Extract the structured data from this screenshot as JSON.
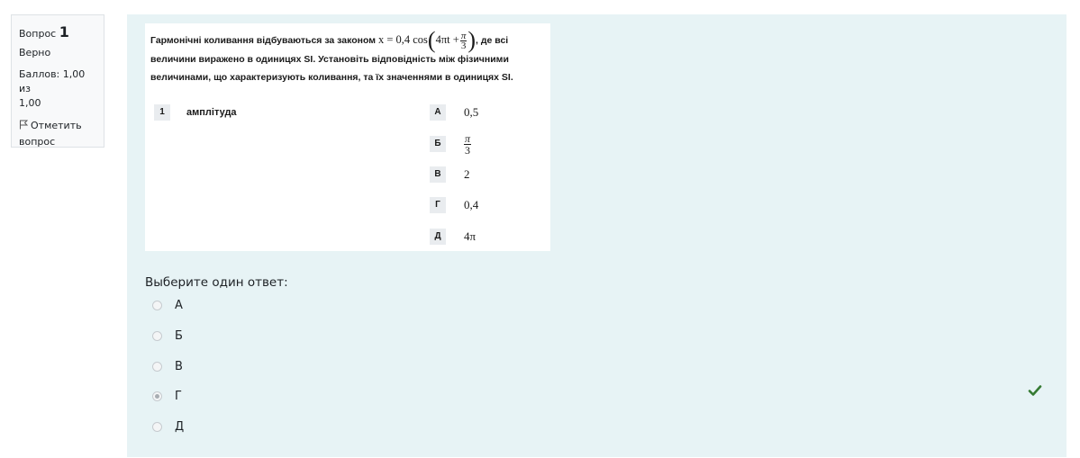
{
  "info": {
    "question_word": "Вопрос",
    "question_number": "1",
    "state": "Верно",
    "grade_line1": "Баллов: 1,00 из",
    "grade_line2": "1,00",
    "flag_line1": "Отметить",
    "flag_line2": "вопрос"
  },
  "question": {
    "text_part1": "Гармонічні коливання відбуваються за законом",
    "formula_lhs": "x = 0,4 cos",
    "formula_inner": "4πt +",
    "formula_frac_num": "π",
    "formula_frac_den": "3",
    "text_part2": ", де всі",
    "text_line2": "величини виражено в одиницях SI. Установіть відповідність між фізичними",
    "text_line3": "величинами, що характеризують коливання, та їх значеннями в одиницях SI.",
    "left_items": [
      {
        "tag": "1",
        "label": "амплітуда"
      }
    ],
    "right_items": [
      {
        "tag": "А",
        "value": "0,5"
      },
      {
        "tag": "Б",
        "value_num": "π",
        "value_den": "3"
      },
      {
        "tag": "В",
        "value": "2"
      },
      {
        "tag": "Г",
        "value": "0,4"
      },
      {
        "tag": "Д",
        "value": "4π"
      }
    ]
  },
  "answer": {
    "prompt": "Выберите один ответ:",
    "options": [
      {
        "label": "А",
        "checked": false
      },
      {
        "label": "Б",
        "checked": false
      },
      {
        "label": "В",
        "checked": false
      },
      {
        "label": "Г",
        "checked": true
      },
      {
        "label": "Д",
        "checked": false
      }
    ],
    "correct_icon": "check-icon",
    "correct_color": "#357a32"
  }
}
